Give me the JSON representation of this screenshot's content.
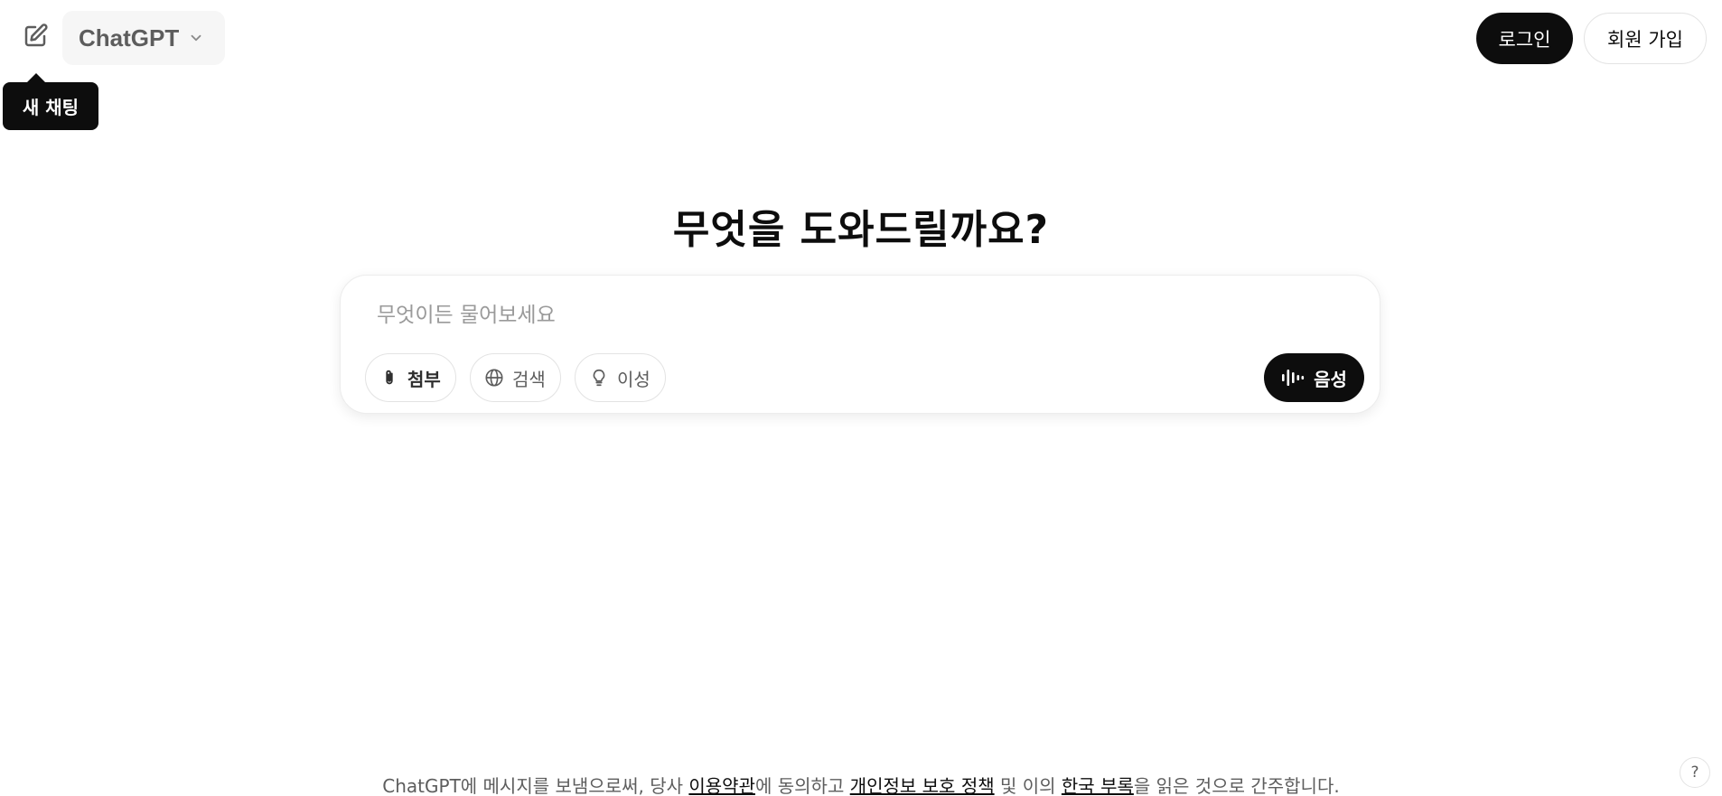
{
  "header": {
    "model_name": "ChatGPT",
    "tooltip": "새 채팅",
    "login_label": "로그인",
    "signup_label": "회원 가입",
    "icons": {
      "new_chat": "pencil-square-icon",
      "model_dropdown": "chevron-down-icon"
    }
  },
  "main": {
    "headline": "무엇을 도와드릴까요?",
    "prompt_placeholder": "무엇이든 물어보세요",
    "prompt_value": "",
    "tools": [
      {
        "label": "첨부",
        "icon": "paperclip-icon"
      },
      {
        "label": "검색",
        "icon": "globe-icon"
      },
      {
        "label": "이성",
        "icon": "lightbulb-icon"
      }
    ],
    "voice_label": "음성",
    "voice_icon": "waveform-icon"
  },
  "footer": {
    "text_1": "ChatGPT에 메시지를 보냄으로써, 당사 ",
    "link_terms": "이용약관",
    "text_2": "에 동의하고 ",
    "link_privacy": "개인정보 보호 정책",
    "text_3": " 및 이의 ",
    "link_appendix": "한국 부록",
    "text_4": "을 읽은 것으로 간주합니다.",
    "help_label": "?"
  },
  "colors": {
    "primary_dark": "#0d0d0d",
    "muted_text": "#5d5d5d",
    "border": "#e3e3e3",
    "placeholder": "#9a9a9a",
    "model_selector_bg": "#f6f6f6"
  }
}
